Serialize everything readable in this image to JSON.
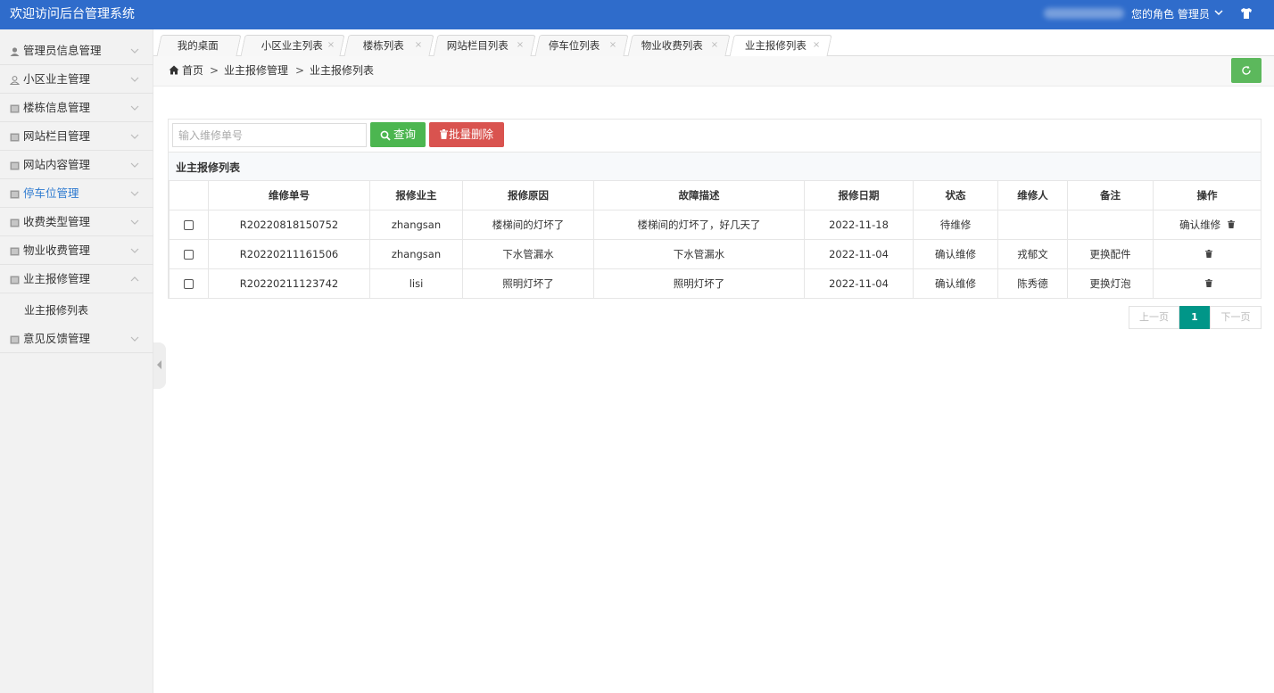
{
  "header": {
    "app_title": "欢迎访问后台管理系统",
    "role_text": "您的角色 管理员",
    "colors": {
      "header_bg": "#2f6ccb",
      "active_menu": "#2f7bd0",
      "query_btn": "#4cb650",
      "delete_btn": "#d9534f",
      "page_current": "#009688"
    }
  },
  "sidebar": {
    "items": [
      {
        "label": "管理员信息管理",
        "icon": "user-icon"
      },
      {
        "label": "小区业主管理",
        "icon": "user-outline-icon"
      },
      {
        "label": "楼栋信息管理",
        "icon": "list-icon"
      },
      {
        "label": "网站栏目管理",
        "icon": "list-icon"
      },
      {
        "label": "网站内容管理",
        "icon": "list-icon"
      },
      {
        "label": "停车位管理",
        "icon": "list-icon"
      },
      {
        "label": "收费类型管理",
        "icon": "list-icon"
      },
      {
        "label": "物业收费管理",
        "icon": "list-icon"
      },
      {
        "label": "业主报修管理",
        "icon": "list-icon"
      },
      {
        "label": "意见反馈管理",
        "icon": "list-icon"
      }
    ],
    "subitem": {
      "label": "业主报修列表"
    }
  },
  "tabs": [
    {
      "label": "我的桌面"
    },
    {
      "label": "小区业主列表"
    },
    {
      "label": "楼栋列表"
    },
    {
      "label": "网站栏目列表"
    },
    {
      "label": "停车位列表"
    },
    {
      "label": "物业收费列表"
    },
    {
      "label": "业主报修列表"
    }
  ],
  "tab_close": "×",
  "breadcrumb": {
    "home": "首页",
    "sep": ">",
    "level1": "业主报修管理",
    "level2": "业主报修列表"
  },
  "search": {
    "placeholder": "输入维修单号",
    "query_label": "查询",
    "batch_delete_label": "批量删除"
  },
  "table": {
    "title": "业主报修列表",
    "columns": [
      "维修单号",
      "报修业主",
      "报修原因",
      "故障描述",
      "报修日期",
      "状态",
      "维修人",
      "备注",
      "操作"
    ],
    "rows": [
      {
        "order_no": "R20220818150752",
        "owner": "zhangsan",
        "reason": "楼梯间的灯坏了",
        "description": "楼梯间的灯坏了，好几天了",
        "date": "2022-11-18",
        "status": "待维修",
        "repairer": "",
        "remark": "",
        "action": "确认维修"
      },
      {
        "order_no": "R20220211161506",
        "owner": "zhangsan",
        "reason": "下水管漏水",
        "description": "下水管漏水",
        "date": "2022-11-04",
        "status": "确认维修",
        "repairer": "戎郁文",
        "remark": "更换配件",
        "action": ""
      },
      {
        "order_no": "R20220211123742",
        "owner": "lisi",
        "reason": "照明灯坏了",
        "description": "照明灯坏了",
        "date": "2022-11-04",
        "status": "确认维修",
        "repairer": "陈秀德",
        "remark": "更换灯泡",
        "action": ""
      }
    ]
  },
  "pagination": {
    "prev": "上一页",
    "current": "1",
    "next": "下一页"
  }
}
